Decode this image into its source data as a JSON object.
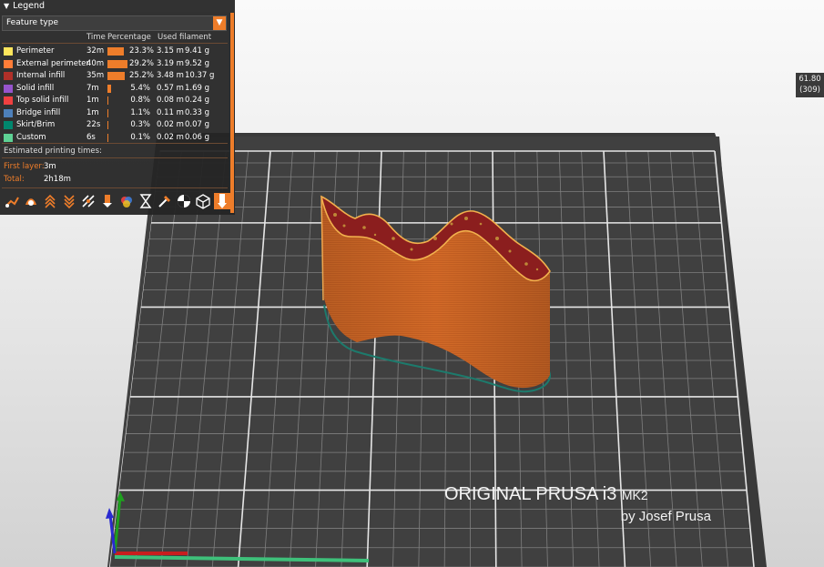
{
  "legend": {
    "title": "Legend",
    "view_type": "Feature type",
    "columns": {
      "time": "Time",
      "percentage": "Percentage",
      "used_filament": "Used filament"
    },
    "rows": [
      {
        "label": "Perimeter",
        "color": "#ffe65c",
        "time": "32m",
        "percent": "23.3%",
        "length": "3.15 m",
        "weight": "9.41 g"
      },
      {
        "label": "External perimeter",
        "color": "#ff7d38",
        "time": "40m",
        "percent": "29.2%",
        "length": "3.19 m",
        "weight": "9.52 g"
      },
      {
        "label": "Internal infill",
        "color": "#b03029",
        "time": "35m",
        "percent": "25.2%",
        "length": "3.48 m",
        "weight": "10.37 g"
      },
      {
        "label": "Solid infill",
        "color": "#9654cc",
        "time": "7m",
        "percent": "5.4%",
        "length": "0.57 m",
        "weight": "1.69 g"
      },
      {
        "label": "Top solid infill",
        "color": "#f04040",
        "time": "1m",
        "percent": "0.8%",
        "length": "0.08 m",
        "weight": "0.24 g"
      },
      {
        "label": "Bridge infill",
        "color": "#4d80ba",
        "time": "1m",
        "percent": "1.1%",
        "length": "0.11 m",
        "weight": "0.33 g"
      },
      {
        "label": "Skirt/Brim",
        "color": "#00876e",
        "time": "22s",
        "percent": "0.3%",
        "length": "0.02 m",
        "weight": "0.07 g"
      },
      {
        "label": "Custom",
        "color": "#5ed194",
        "time": "6s",
        "percent": "0.1%",
        "length": "0.02 m",
        "weight": "0.06 g"
      }
    ],
    "estimated_title": "Estimated printing times:",
    "first_layer_label": "First layer:",
    "first_layer_value": "3m",
    "total_label": "Total:",
    "total_value": "2h18m",
    "toolbar_icons": [
      "travel-icon",
      "wipe-icon",
      "retractions-icon",
      "deretractions-icon",
      "seams-icon",
      "tool-changes-icon",
      "color-changes-icon",
      "pause-icon",
      "custom-gcode-icon",
      "center-of-gravity-icon",
      "shells-icon",
      "tool-marker-icon"
    ]
  },
  "coordinate_readout": {
    "value": "61.80",
    "layer": "(309)"
  },
  "bed_logo": {
    "line1": "ORIGINAL PRUSA i3",
    "line1_suffix": "MK2",
    "line2": "by Josef Prusa"
  },
  "colors": {
    "accent": "#ee7d2a",
    "model": "#d86f2a"
  }
}
